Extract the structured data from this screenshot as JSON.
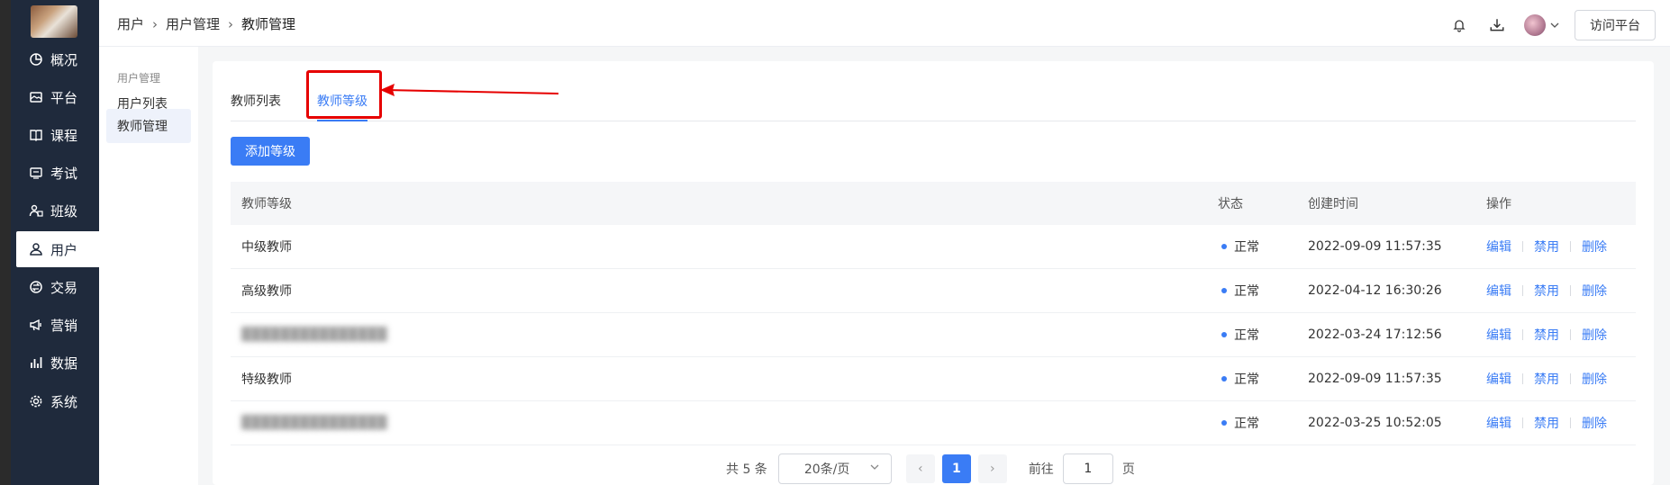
{
  "sidebar": {
    "items": [
      {
        "label": "概况",
        "icon": "pie-chart-icon"
      },
      {
        "label": "平台",
        "icon": "image-icon"
      },
      {
        "label": "课程",
        "icon": "book-icon"
      },
      {
        "label": "考试",
        "icon": "exam-icon"
      },
      {
        "label": "班级",
        "icon": "class-icon"
      },
      {
        "label": "用户",
        "icon": "user-icon",
        "active": true
      },
      {
        "label": "交易",
        "icon": "transaction-icon"
      },
      {
        "label": "营销",
        "icon": "megaphone-icon"
      },
      {
        "label": "数据",
        "icon": "bar-chart-icon"
      },
      {
        "label": "系统",
        "icon": "gear-icon"
      }
    ]
  },
  "header": {
    "breadcrumb": [
      "用户",
      "用户管理",
      "教师管理"
    ],
    "visit_label": "访问平台"
  },
  "subnav": {
    "title": "用户管理",
    "items": [
      {
        "label": "用户列表"
      },
      {
        "label": "教师管理",
        "active": true
      }
    ]
  },
  "tabs": [
    {
      "label": "教师列表"
    },
    {
      "label": "教师等级",
      "active": true
    }
  ],
  "add_button": "添加等级",
  "table": {
    "columns": [
      "教师等级",
      "状态",
      "创建时间",
      "操作"
    ],
    "rows": [
      {
        "level": "中级教师",
        "status": "正常",
        "created": "2022-09-09 11:57:35",
        "blurred": false
      },
      {
        "level": "高级教师",
        "status": "正常",
        "created": "2022-04-12 16:30:26",
        "blurred": false
      },
      {
        "level": "",
        "status": "正常",
        "created": "2022-03-24 17:12:56",
        "blurred": true
      },
      {
        "level": "特级教师",
        "status": "正常",
        "created": "2022-09-09 11:57:35",
        "blurred": false
      },
      {
        "level": "",
        "status": "正常",
        "created": "2022-03-25 10:52:05",
        "blurred": true
      }
    ],
    "actions": [
      "编辑",
      "禁用",
      "删除"
    ]
  },
  "pagination": {
    "total": "共 5 条",
    "page_size": "20条/页",
    "current": "1",
    "goto_label": "前往",
    "goto_value": "1",
    "page_unit": "页"
  },
  "colors": {
    "accent": "#3a7cf5",
    "sidebar": "#1f2a3c",
    "annotation": "#e60000"
  }
}
